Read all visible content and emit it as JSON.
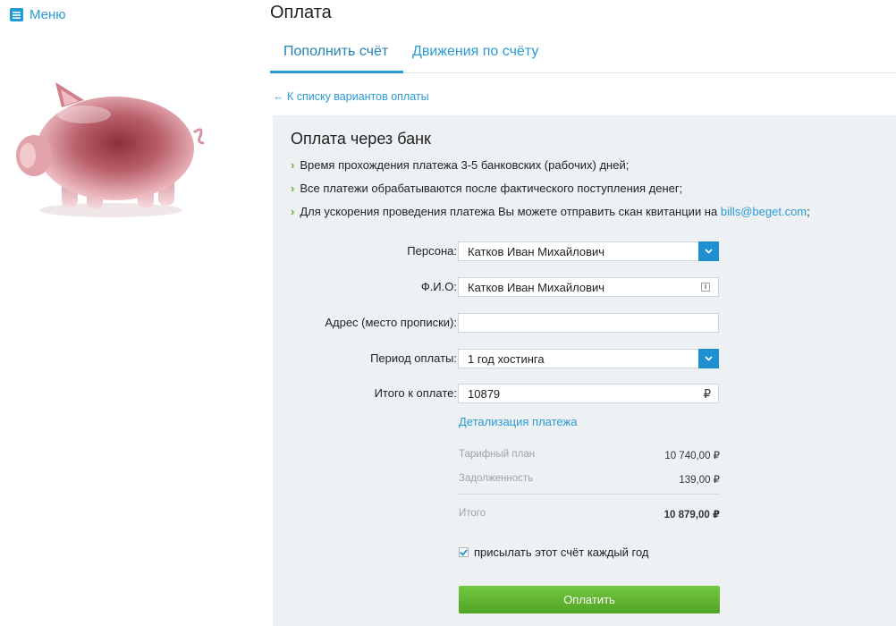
{
  "menu": {
    "label": "Меню"
  },
  "page_title": "Оплата",
  "tabs": [
    {
      "label": "Пополнить счёт",
      "active": true
    },
    {
      "label": "Движения по счёту",
      "active": false
    }
  ],
  "back_link": "← К списку вариантов оплаты",
  "panel": {
    "title": "Оплата через банк",
    "bullets": [
      "Время прохождения платежа 3-5 банковских (рабочих) дней;",
      "Все платежи обрабатываются после фактического поступления денег;",
      "Для ускорения проведения платежа Вы можете отправить скан квитанции на "
    ],
    "bullet_email": "bills@beget.com",
    "bullet_email_suffix": ";",
    "bullet_marker": "›"
  },
  "form": {
    "person": {
      "label": "Персона:",
      "value": "Катков Иван Михайлович"
    },
    "fio": {
      "label": "Ф.И.О:",
      "value": "Катков Иван Михайлович"
    },
    "address": {
      "label": "Адрес (место прописки):",
      "value": ""
    },
    "period": {
      "label": "Период оплаты:",
      "value": "1 год хостинга"
    },
    "total": {
      "label": "Итого к оплате:",
      "value": "10879",
      "currency": "₽"
    }
  },
  "details": {
    "link": "Детализация платежа",
    "rows": [
      {
        "label": "Тарифный план",
        "value": "10 740,00 ₽"
      },
      {
        "label": "Задолженность",
        "value": "139,00 ₽"
      }
    ],
    "total_label": "Итого",
    "total_value": "10 879,00 ₽"
  },
  "checkbox": {
    "label": "присылать этот счёт каждый год",
    "checked": true
  },
  "pay_button": "Оплатить",
  "colors": {
    "accent": "#2a9ad6",
    "panel_bg": "#edf1f4",
    "button_green": "#5cb22e",
    "bullet_marker": "#6ab42b"
  },
  "icons": {
    "menu": "hamburger-icon",
    "dropdown": "chevron-down-icon",
    "card": "id-card-icon",
    "illustration": "piggy-bank"
  }
}
